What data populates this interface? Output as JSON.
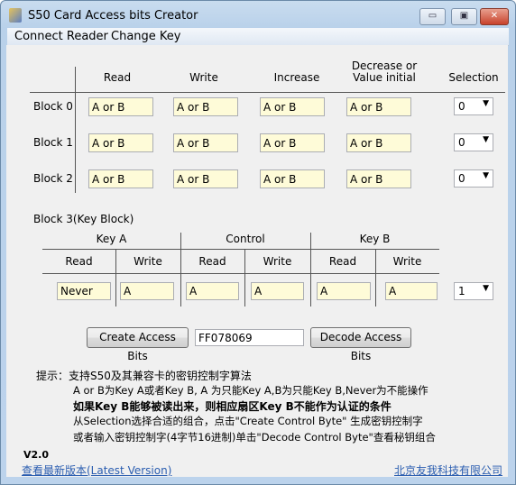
{
  "window": {
    "title": "S50 Card Access bits Creator",
    "minimize": "▭",
    "maximize": "▣",
    "close": "✕"
  },
  "menu": [
    "Connect Reader",
    "Change Key"
  ],
  "data_blocks": {
    "headers": [
      "Read",
      "Write",
      "Increase",
      "Decrease or",
      "Value initial",
      "Selection"
    ],
    "rows": [
      {
        "label": "Block 0",
        "values": [
          "A or B",
          "A or B",
          "A or B",
          "A or B"
        ],
        "selection": "0"
      },
      {
        "label": "Block 1",
        "values": [
          "A or B",
          "A or B",
          "A or B",
          "A or B"
        ],
        "selection": "0"
      },
      {
        "label": "Block 2",
        "values": [
          "A or B",
          "A or B",
          "A or B",
          "A or B"
        ],
        "selection": "0"
      }
    ]
  },
  "key_block": {
    "label": "Block 3(Key Block)",
    "groups": [
      "Key A",
      "Control",
      "Key B"
    ],
    "subheaders": [
      "Read",
      "Write",
      "Read",
      "Write",
      "Read",
      "Write"
    ],
    "values": [
      "Never",
      "A",
      "A",
      "A",
      "A",
      "A"
    ],
    "selection": "1"
  },
  "actions": {
    "create": "Create Access Bits",
    "access_bits": "FF078069",
    "decode": "Decode Access Bits"
  },
  "hints": [
    "提示：支持S50及其兼容卡的密钥控制字算法",
    "A or B为Key A或者Key B, A 为只能Key A,B为只能Key B,Never为不能操作",
    "如果Key B能够被读出来，则相应扇区Key B不能作为认证的条件",
    "从Selection选择合适的组合，点击\"Create Control Byte\" 生成密钥控制字",
    "或者输入密钥控制字(4字节16进制)单击\"Decode Control Byte\"查看秘钥组合"
  ],
  "footer": {
    "version": "V2.0",
    "latest_link": "查看最新版本(Latest Version)",
    "company": "北京友我科技有限公司"
  }
}
